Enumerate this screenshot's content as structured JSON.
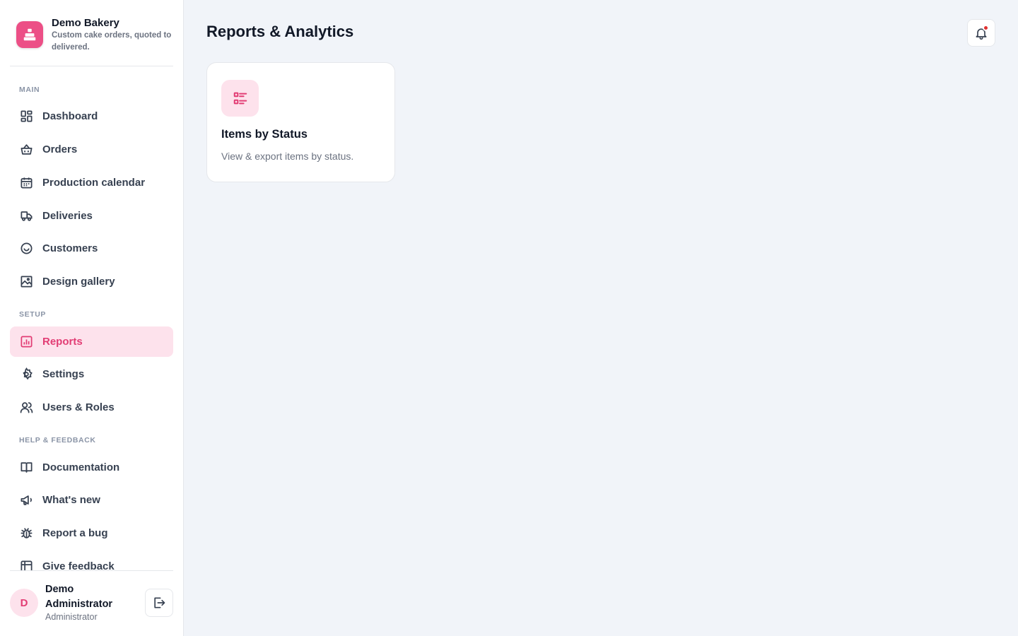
{
  "brand": {
    "name": "Demo Bakery",
    "tagline": "Custom cake orders, quoted to delivered.",
    "accent": "#e23d74"
  },
  "sidebar": {
    "sections": {
      "main": "MAIN",
      "setup": "SETUP",
      "help": "HELP & FEEDBACK"
    },
    "main_items": [
      {
        "label": "Dashboard",
        "icon": "dashboard-icon"
      },
      {
        "label": "Orders",
        "icon": "basket-icon"
      },
      {
        "label": "Production calendar",
        "icon": "calendar-icon"
      },
      {
        "label": "Deliveries",
        "icon": "delivery-icon"
      },
      {
        "label": "Customers",
        "icon": "smile-icon"
      },
      {
        "label": "Design gallery",
        "icon": "image-icon"
      }
    ],
    "setup_items": [
      {
        "label": "Reports",
        "icon": "bar-chart-icon",
        "active": true
      },
      {
        "label": "Settings",
        "icon": "gear-icon"
      },
      {
        "label": "Users & Roles",
        "icon": "users-icon"
      }
    ],
    "help_items": [
      {
        "label": "Documentation",
        "icon": "book-icon"
      },
      {
        "label": "What's new",
        "icon": "megaphone-icon"
      },
      {
        "label": "Report a bug",
        "icon": "bug-icon"
      },
      {
        "label": "Give feedback",
        "icon": "feedback-icon"
      }
    ]
  },
  "user": {
    "initial": "D",
    "name": "Demo Administrator",
    "role": "Administrator"
  },
  "header": {
    "title": "Reports & Analytics"
  },
  "reports": [
    {
      "title": "Items by Status",
      "description": "View & export items by status.",
      "icon": "list-icon"
    }
  ]
}
